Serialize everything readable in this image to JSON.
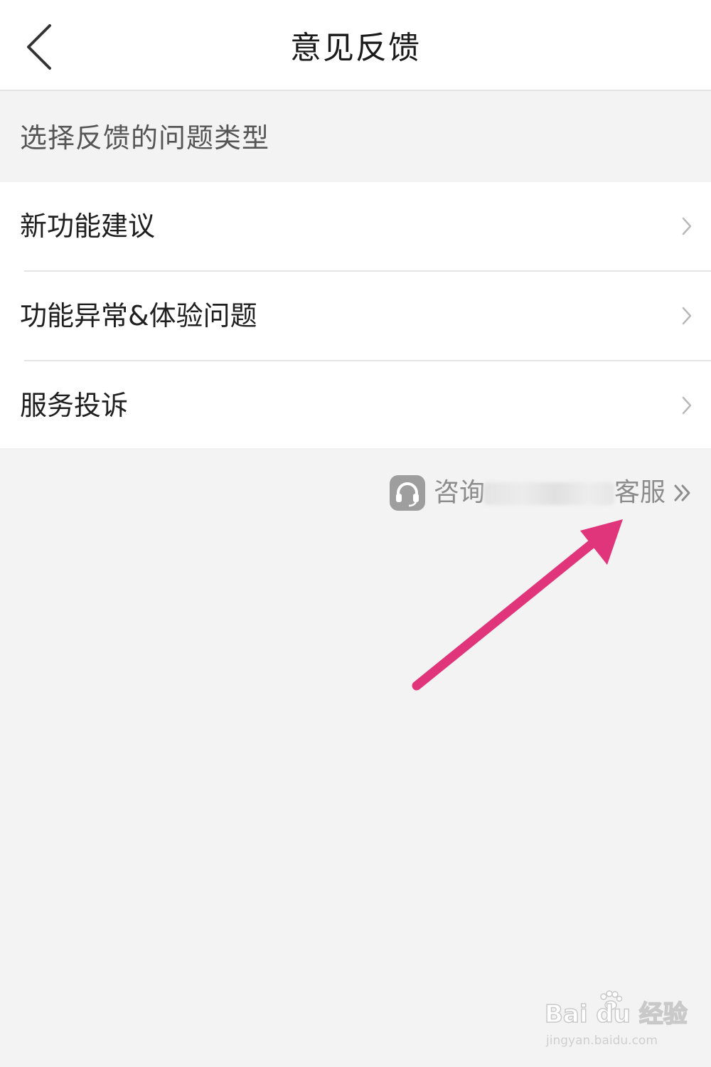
{
  "header": {
    "title": "意见反馈",
    "back_icon": "chevron-left-icon"
  },
  "section": {
    "title": "选择反馈的问题类型"
  },
  "feedback_types": [
    {
      "label": "新功能建议",
      "icon": "chevron-right-icon"
    },
    {
      "label": "功能异常&体验问题",
      "icon": "chevron-right-icon"
    },
    {
      "label": "服务投诉",
      "icon": "chevron-right-icon"
    }
  ],
  "consult": {
    "icon": "headset-icon",
    "prefix": "咨询",
    "suffix": "客服",
    "more_icon": "double-chevron-right-icon"
  },
  "annotation": {
    "icon": "pointer-arrow-icon",
    "color": "#e0357a"
  },
  "watermark": {
    "logo_text": "Bai du 经验",
    "url": "jingyan.baidu.com"
  },
  "colors": {
    "page_bg": "#f3f3f3",
    "card_bg": "#ffffff",
    "divider": "#e4e4e4",
    "muted_text": "#8c8c8c",
    "arrow": "#e0357a"
  }
}
